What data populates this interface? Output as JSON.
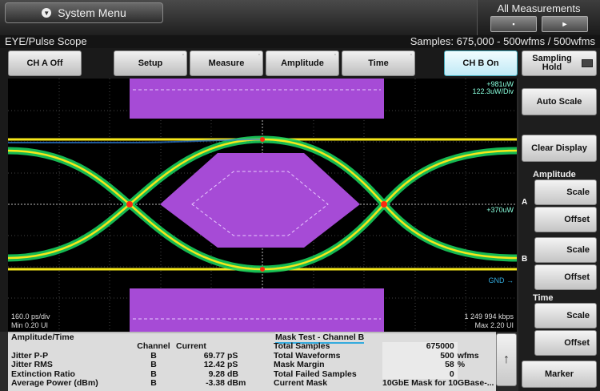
{
  "topbar": {
    "system_menu_label": "System Menu",
    "all_measurements_label": "All Measurements",
    "btn_left": "▪",
    "btn_right": "►"
  },
  "titlebar": {
    "left": "EYE/Pulse Scope",
    "right": "Samples: 675,000 - 500wfms / 500wfms"
  },
  "toolbar": {
    "ch_a": "CH A Off",
    "setup": "Setup",
    "measure": "Measure",
    "amplitude": "Amplitude",
    "time": "Time",
    "ch_b": "CH B On"
  },
  "rpanel": {
    "sampling_hold": "Sampling Hold",
    "auto_scale": "Auto Scale",
    "clear_display": "Clear Display",
    "amplitude_label": "Amplitude",
    "scale": "Scale",
    "offset": "Offset",
    "time_label": "Time",
    "marker": "Marker"
  },
  "screen": {
    "top_right_1": "+981uW",
    "top_right_2": "122.3uW/Div",
    "mid_right": "+370uW",
    "gnd": "GND",
    "marker_a": "A",
    "marker_b": "B",
    "bottom_left_1": "160.0 ps/div",
    "bottom_left_2": "Min 0.20 UI",
    "bottom_right_1": "1 249 994 kbps",
    "bottom_right_2": "Max 2.20 UI"
  },
  "amplitude_time": {
    "title": "Amplitude/Time",
    "headers": [
      "",
      "Channel",
      "Current",
      ""
    ],
    "rows": [
      [
        "Jitter P-P",
        "B",
        "69.77",
        "pS"
      ],
      [
        "Jitter RMS",
        "B",
        "12.42",
        "pS"
      ],
      [
        "Extinction Ratio",
        "B",
        "9.28",
        "dB"
      ],
      [
        "Average Power (dBm)",
        "B",
        "-3.38",
        "dBm"
      ]
    ]
  },
  "mask_test": {
    "title": "Mask Test - Channel B",
    "rows": [
      [
        "Total Samples",
        "675000",
        ""
      ],
      [
        "Total Waveforms",
        "500",
        "wfms"
      ],
      [
        "Mask Margin",
        "58",
        "%"
      ],
      [
        "Total Failed Samples",
        "0",
        ""
      ]
    ],
    "current_mask_label": "Current Mask",
    "current_mask_value": "10GbE  Mask for 10GBase-..."
  },
  "colors": {
    "mask_fill": "#a64bd6",
    "trace_hot": "#ff2a10",
    "trace_mid": "#f6e71a",
    "trace_cool": "#1ad860",
    "trace_edge": "#2a7bd6",
    "active_ch": "#3ab8d6"
  }
}
